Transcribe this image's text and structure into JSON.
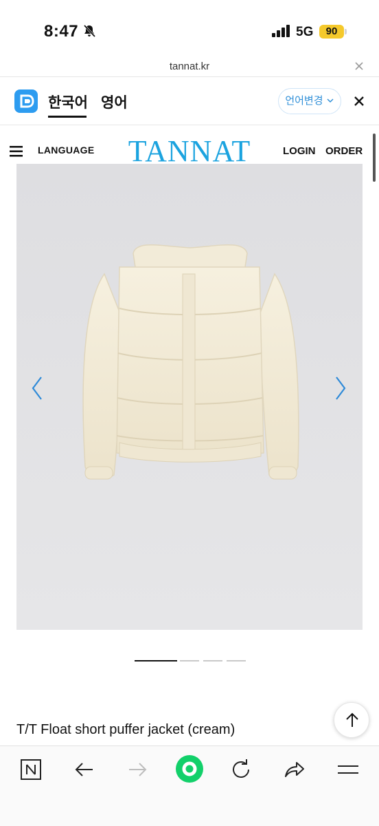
{
  "status_bar": {
    "time": "8:47",
    "network": "5G",
    "battery": "90"
  },
  "url_bar": {
    "url": "tannat.kr"
  },
  "translate_bar": {
    "tabs": [
      {
        "label": "한국어"
      },
      {
        "label": "영어"
      }
    ],
    "change_button": "언어변경"
  },
  "site": {
    "nav": {
      "language": "LANGUAGE",
      "brand": "TANNAT",
      "login": "LOGIN",
      "order": "ORDER"
    },
    "carousel": {
      "slide_count": 4,
      "active_index": 0
    },
    "product": {
      "title": "T/T Float short puffer jacket (cream)"
    }
  },
  "colors": {
    "brand": "#1ba3df",
    "accent_green": "#12d06a",
    "arrow_blue": "#2e8ad8",
    "battery": "#f5c92b"
  },
  "toolbar": {
    "icons": [
      "naver-icon",
      "back-arrow-icon",
      "forward-arrow-icon",
      "home-circle-icon",
      "refresh-icon",
      "share-icon",
      "menu-icon"
    ]
  }
}
